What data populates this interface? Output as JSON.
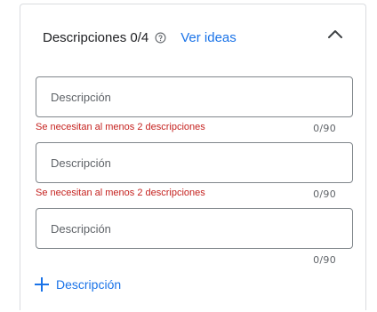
{
  "header": {
    "title": "Descripciones 0/4",
    "ideas_link": "Ver ideas"
  },
  "descriptions": [
    {
      "placeholder": "Descripción",
      "value": "",
      "error": "Se necesitan al menos 2 descripciones",
      "counter": "0/90"
    },
    {
      "placeholder": "Descripción",
      "value": "",
      "error": "Se necesitan al menos 2 descripciones",
      "counter": "0/90"
    },
    {
      "placeholder": "Descripción",
      "value": "",
      "error": "",
      "counter": "0/90"
    }
  ],
  "add_button": {
    "label": "Descripción"
  },
  "colors": {
    "accent": "#1a73e8",
    "error": "#c5221f",
    "border": "#80868b",
    "card_border": "#dadce0"
  },
  "icons": {
    "help": "help-circle-icon",
    "collapse": "chevron-up-icon",
    "add": "plus-icon"
  }
}
